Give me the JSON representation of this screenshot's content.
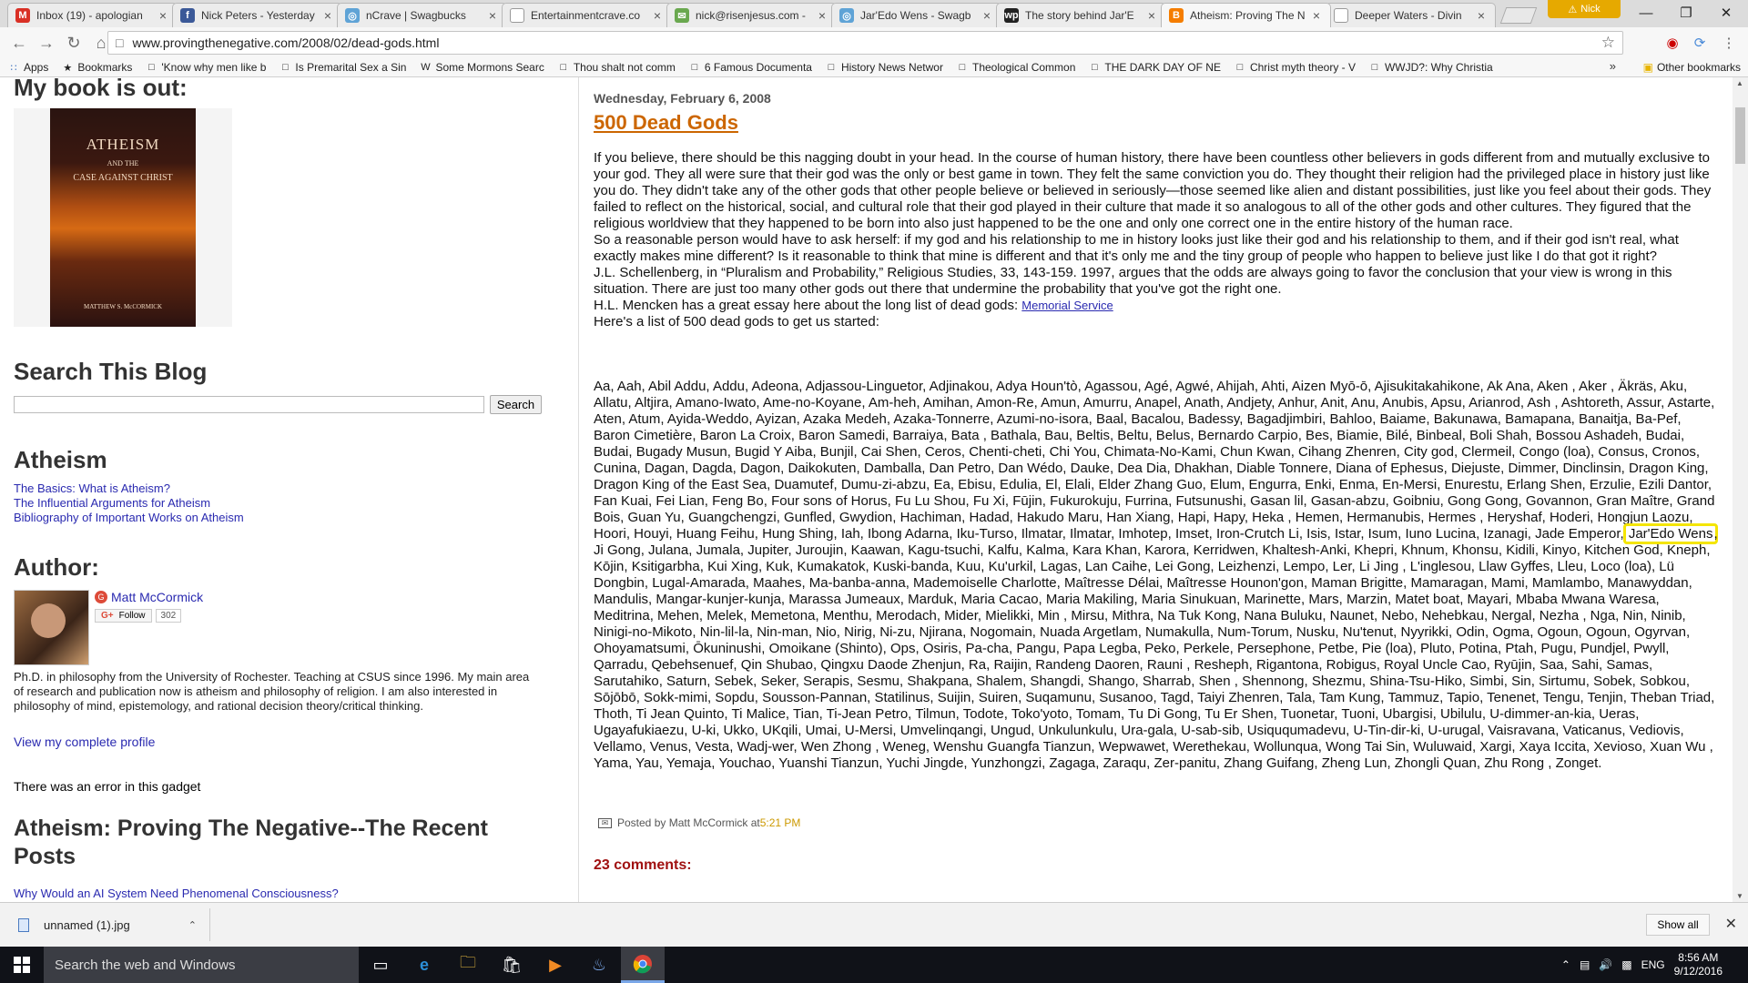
{
  "browser": {
    "tabs": [
      {
        "title": "Inbox (19) - apologian",
        "favicon": "gmail-icon",
        "color": "#d93025",
        "glyph": "M"
      },
      {
        "title": "Nick Peters - Yesterday",
        "favicon": "facebook-icon",
        "color": "#3b5998",
        "glyph": "f"
      },
      {
        "title": "nCrave | Swagbucks",
        "favicon": "swagbucks-icon",
        "color": "#5fa3d6",
        "glyph": "◎"
      },
      {
        "title": "Entertainmentcrave.co",
        "favicon": "page-icon",
        "color": "#ffffff",
        "glyph": ""
      },
      {
        "title": "nick@risenjesus.com -",
        "favicon": "mail-icon",
        "color": "#6aa84f",
        "glyph": "✉"
      },
      {
        "title": "Jar'Edo Wens - Swagb",
        "favicon": "swagbucks-icon",
        "color": "#5fa3d6",
        "glyph": "◎"
      },
      {
        "title": "The story behind Jar'E",
        "favicon": "wp-icon",
        "color": "#222222",
        "glyph": "wp"
      },
      {
        "title": "Atheism: Proving The N",
        "favicon": "blogger-icon",
        "color": "#f57d00",
        "glyph": "B"
      },
      {
        "title": "Deeper Waters - Divin",
        "favicon": "page-icon",
        "color": "#ffffff",
        "glyph": ""
      }
    ],
    "active_tab": 7,
    "profile_name": "Nick",
    "url": "www.provingthenegative.com/2008/02/dead-gods.html",
    "bookmarks": [
      {
        "label": "Apps",
        "icon": "apps-grid-icon"
      },
      {
        "label": "Bookmarks",
        "icon": "star-icon"
      },
      {
        "label": "'Know why men like b",
        "icon": "page-icon"
      },
      {
        "label": "Is Premarital Sex a Sin",
        "icon": "page-icon"
      },
      {
        "label": "Some Mormons Searc",
        "icon": "wordpress-icon"
      },
      {
        "label": "Thou shalt not comm",
        "icon": "page-icon"
      },
      {
        "label": "6 Famous Documenta",
        "icon": "page-icon"
      },
      {
        "label": "History News Networ",
        "icon": "page-icon"
      },
      {
        "label": "Theological Common",
        "icon": "page-icon"
      },
      {
        "label": "THE DARK DAY OF NE",
        "icon": "page-icon"
      },
      {
        "label": "Christ myth theory - V",
        "icon": "page-icon"
      },
      {
        "label": "WWJD?: Why Christia",
        "icon": "page-icon"
      }
    ],
    "bookmarks_more": "»",
    "other_bookmarks": "Other bookmarks"
  },
  "sidebar": {
    "book_heading": "My book is out:",
    "book_cover": {
      "title": "ATHEISM",
      "subtitle_and": "AND THE",
      "subtitle": "CASE AGAINST CHRIST",
      "author": "MATTHEW S. McCORMICK"
    },
    "search_heading": "Search This Blog",
    "search_button": "Search",
    "search_value": "",
    "atheism_heading": "Atheism",
    "atheism_links": [
      "The Basics: What is Atheism?",
      "The Influential Arguments for Atheism",
      "Bibliography of Important Works on Atheism"
    ],
    "author_heading": "Author:",
    "author_name": "Matt McCormick",
    "follow_label": "Follow",
    "follow_count": "302",
    "author_bio": "Ph.D. in philosophy from the University of Rochester.  Teaching at CSUS since 1996.  My main area of research and publication now is atheism and philosophy of religion.  I am also interested in philosophy of mind, epistemology, and rational decision theory/critical thinking.",
    "profile_link": "View my complete profile",
    "gadget_error": "There was an error in this gadget",
    "recent_heading": "Atheism: Proving The Negative--The Recent Posts",
    "recent_first": "Why Would an AI System Need Phenomenal Consciousness?"
  },
  "post": {
    "date": "Wednesday, February 6, 2008",
    "title": "500 Dead Gods",
    "paragraphs": [
      "If you believe, there should be this nagging doubt in your head. In the course of human history, there have been countless other believers in gods different from and mutually exclusive to your god. They all were sure that their god was the only or best game in town. They felt the same conviction you do. They thought their religion had the privileged place in history just like you do. They didn't take any of the other gods that other people believe or believed in seriously—those seemed like alien and distant possibilities, just like you feel about their gods. They failed to reflect on the historical, social, and cultural role that their god played in their culture that made it so analogous to all of the other gods and other cultures. They figured that the religious worldview that they happened to be born into also just happened to be the one and only one correct one in the entire history of the human race.",
      "So a reasonable person would have to ask herself: if my god and his relationship to me in history looks just like their god and his relationship to them, and if their god isn't real, what exactly makes mine different? Is it reasonable to think that mine is different and that it's only me and the tiny group of people who happen to believe just like I do that got it right?",
      "J.L. Schellenberg, in “Pluralism and Probability,” Religious Studies, 33, 143-159. 1997, argues that the odds are always going to favor the conclusion that your view is wrong in this situation. There are just too many other gods out there that undermine the probability that you've got the right one."
    ],
    "mencken_text": "H.L. Mencken has a great essay here about the long list of dead gods: ",
    "mencken_link": "Memorial Service",
    "list_intro": "Here's a list of 500 dead gods to get us started:",
    "gods_before": "Aa, Aah, Abil Addu, Addu, Adeona, Adjassou-Linguetor, Adjinakou, Adya Houn'tò, Agassou, Agé, Agwé, Ahijah, Ahti, Aizen Myō-ō, Ajisukitakahikone, Ak Ana, Aken , Aker , Äkräs, Aku, Allatu, Altjira, Amano-Iwato, Ame-no-Koyane, Am-heh, Amihan, Amon-Re, Amun, Amurru, Anapel, Anath, Andjety, Anhur, Anit, Anu, Anubis, Apsu, Arianrod, Ash , Ashtoreth, Assur, Astarte, Aten, Atum, Ayida-Weddo, Ayizan, Azaka Medeh, Azaka-Tonnerre, Azumi-no-isora, Baal, Bacalou, Badessy, Bagadjimbiri, Bahloo, Baiame, Bakunawa, Bamapana, Banaitja, Ba-Pef, Baron Cimetière, Baron La Croix, Baron Samedi, Barraiya, Bata , Bathala, Bau, Beltis, Beltu, Belus, Bernardo Carpio, Bes, Biamie, Bilé, Binbeal, Boli Shah, Bossou Ashadeh, Budai, Budai, Bugady Musun, Bugid Y Aiba, Bunjil, Cai Shen, Ceros, Chenti-cheti, Chi You, Chimata-No-Kami, Chun Kwan, Cihang Zhenren, City god, Clermeil, Congo (loa), Consus, Cronos, Cunina, Dagan, Dagda, Dagon, Daikokuten, Damballa, Dan Petro, Dan Wédo, Dauke, Dea Dia, Dhakhan, Diable Tonnere, Diana of Ephesus, Diejuste, Dimmer, Dinclinsin, Dragon King, Dragon King of the East Sea, Duamutef, Dumu-zi-abzu, Ea, Ebisu, Edulia, El, Elali, Elder Zhang Guo, Elum, Engurra, Enki, Enma, En-Mersi, Enurestu, Erlang Shen, Erzulie, Ezili Dantor, Fan Kuai, Fei Lian, Feng Bo, Four sons of Horus, Fu Lu Shou, Fu Xi, Fūjin, Fukurokuju, Furrina, Futsunushi, Gasan lil, Gasan-abzu, Goibniu, Gong Gong, Govannon, Gran Maître, Grand Bois, Guan Yu, Guangchengzi, Gunfled, Gwydion, Hachiman, Hadad, Hakudo Maru, Han Xiang, Hapi, Hapy, Heka , Hemen, Hermanubis, Hermes , Heryshaf, Hoderi, Hongjun Laozu, Hoori, Houyi, Huang Feihu, Hung Shing, Iah, Ibong Adarna, Iku-Turso, Ilmatar, Ilmatar, Imhotep, Imset, Iron-Crutch Li, Isis, Istar, Isum, Iuno Lucina, Izanagi, Jade Emperor, ",
    "gods_highlight": "Jar'Edo Wens",
    "gods_after": ", Ji Gong, Julana, Jumala, Jupiter, Juroujin, Kaawan, Kagu-tsuchi, Kalfu, Kalma, Kara Khan, Karora, Kerridwen, Khaltesh-Anki, Khepri, Khnum, Khonsu, Kidili, Kinyo, Kitchen God, Kneph, Kōjin, Ksitigarbha, Kui Xing, Kuk, Kumakatok, Kuski-banda, Kuu, Ku'urkil, Lagas, Lan Caihe, Lei Gong, Leizhenzi, Lempo, Ler, Li Jing , L'inglesou, Llaw Gyffes, Lleu, Loco (loa), Lü Dongbin, Lugal-Amarada, Maahes, Ma-banba-anna, Mademoiselle Charlotte, Maîtresse Délai, Maîtresse Hounon'gon, Maman Brigitte, Mamaragan, Mami, Mamlambo, Manawyddan, Mandulis, Mangar-kunjer-kunja, Marassa Jumeaux, Marduk, Maria Cacao, Maria Makiling, Maria Sinukuan, Marinette, Mars, Marzin, Matet boat, Mayari, Mbaba Mwana Waresa, Meditrina, Mehen, Melek, Memetona, Menthu, Merodach, Mider, Mielikki, Min , Mirsu, Mithra, Na Tuk Kong, Nana Buluku, Naunet, Nebo, Nehebkau, Nergal, Nezha , Nga, Nin, Ninib, Ninigi-no-Mikoto, Nin-lil-la, Nin-man, Nio, Nirig, Ni-zu, Njirana, Nogomain, Nuada Argetlam, Numakulla, Num-Torum, Nusku, Nu'tenut, Nyyrikki, Odin, Ogma, Ogoun, Ogoun, Ogyrvan, Ohoyamatsumi, Ōkuninushi, Omoikane (Shinto), Ops, Osiris, Pa-cha, Pangu, Papa Legba, Peko, Perkele, Persephone, Petbe, Pie (loa), Pluto, Potina, Ptah, Pugu, Pundjel, Pwyll, Qarradu, Qebehsenuef, Qin Shubao, Qingxu Daode Zhenjun, Ra, Raijin, Randeng Daoren, Rauni , Resheph, Rigantona, Robigus, Royal Uncle Cao, Ryūjin, Saa, Sahi, Samas, Sarutahiko, Saturn, Sebek, Seker, Serapis, Sesmu, Shakpana, Shalem, Shangdi, Shango, Sharrab, Shen , Shennong, Shezmu, Shina-Tsu-Hiko, Simbi, Sin, Sirtumu, Sobek, Sobkou, Sōjōbō, Sokk-mimi, Sopdu, Sousson-Pannan, Statilinus, Suijin, Suiren, Suqamunu, Susanoo, Tagd, Taiyi Zhenren, Tala, Tam Kung, Tammuz, Tapio, Tenenet, Tengu, Tenjin, Theban Triad, Thoth, Ti Jean Quinto, Ti Malice, Tian, Ti-Jean Petro, Tilmun, Todote, Toko'yoto, Tomam, Tu Di Gong, Tu Er Shen, Tuonetar, Tuoni, Ubargisi, Ubilulu, U-dimmer-an-kia, Ueras, Ugayafukiaezu, U-ki, Ukko, UKqili, Umai, U-Mersi, Umvelinqangi, Ungud, Unkulunkulu, Ura-gala, U-sab-sib, Usiququmadevu, U-Tin-dir-ki, U-urugal, Vaisravana, Vaticanus, Vediovis, Vellamo, Venus, Vesta, Wadj-wer, Wen Zhong , Weneg, Wenshu Guangfa Tianzun, Wepwawet, Werethekau, Wollunqua, Wong Tai Sin, Wuluwaid, Xargi, Xaya Iccita, Xevioso, Xuan Wu , Yama, Yau, Yemaja, Youchao, Yuanshi Tianzun, Yuchi Jingde, Yunzhongzi, Zagaga, Zaraqu, Zer-panitu, Zhang Guifang, Zheng Lun, Zhongli Quan, Zhu Rong , Zonget.",
    "posted_by": "Posted by Matt McCormick at ",
    "posted_time": "5:21 PM",
    "comments": "23 comments:"
  },
  "download_bar": {
    "file": "unnamed (1).jpg",
    "show_all": "Show all"
  },
  "taskbar": {
    "search_placeholder": "Search the web and Windows",
    "language": "ENG",
    "time": "8:56 AM",
    "date": "9/12/2016"
  }
}
